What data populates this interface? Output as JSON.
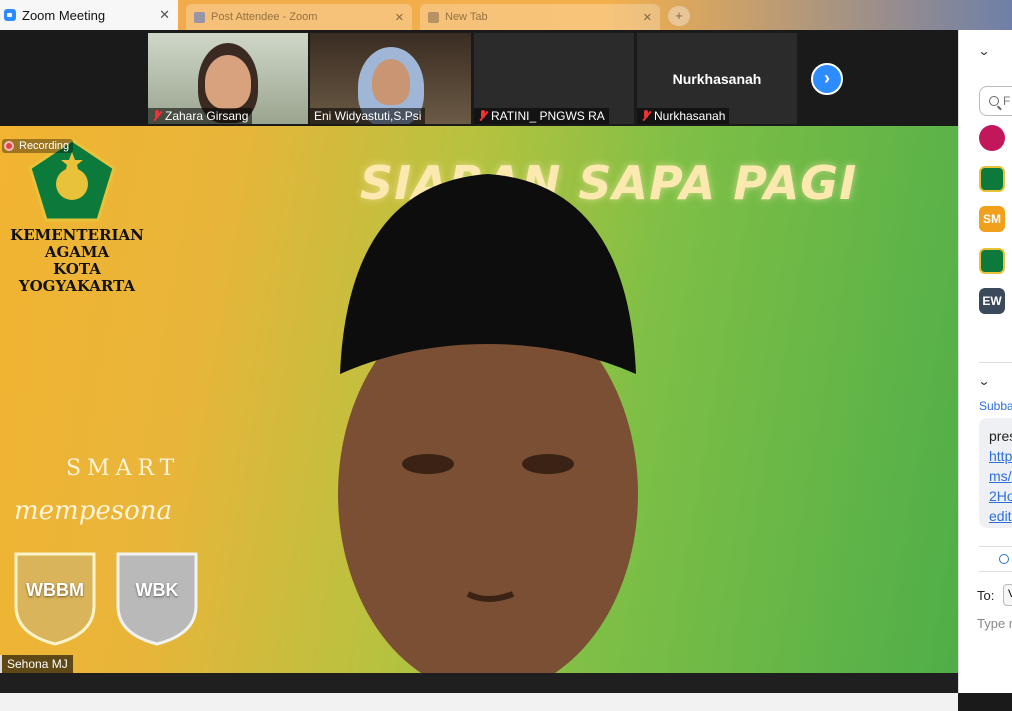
{
  "window": {
    "title": "Zoom Meeting",
    "bg_tab_1": "Post Attendee - Zoom",
    "bg_tab_2": "New Tab"
  },
  "thumbnails": [
    {
      "name": "Zahara Girsang",
      "muted": true
    },
    {
      "name": "Eni Widyastuti,S.Psi",
      "muted": true
    },
    {
      "name": "RATINI_ PNGWS RA",
      "muted": true
    },
    {
      "name": "Nurkhasanah",
      "muted": true,
      "display_name": "Nurkhasanah"
    }
  ],
  "next_icon": "chevron-right-icon",
  "main_video": {
    "recording_label": "Recording",
    "org_line_1": "KEMENTERIAN AGAMA",
    "org_line_2": "KOTA YOGYAKARTA",
    "banner": "SIARAN SAPA PAGI",
    "smart": "SMART",
    "mempesona": "mempesona",
    "badge_1": "WBBM",
    "badge_2": "WBK",
    "speaker_name": "Sehona MJ"
  },
  "panel": {
    "search_placeholder": "F",
    "participants": [
      {
        "initials": "",
        "color": "#c2185b"
      },
      {
        "initials": "",
        "color": "#0b7a3b"
      },
      {
        "initials": "SM",
        "color": "#f0a01a"
      },
      {
        "initials": "",
        "color": "#0b7a3b"
      },
      {
        "initials": "EW",
        "color": "#3b4a5a"
      }
    ],
    "chat_sender": "Subba",
    "chat_text": "pres",
    "chat_link_1": "http",
    "chat_link_2": "ms/",
    "chat_link_3": "2Ho",
    "chat_link_4": "edit",
    "to_label": "To:",
    "to_value": "V",
    "type_placeholder": "Type m"
  },
  "colors": {
    "accent": "#2d8cff",
    "muted_red": "#e33333"
  }
}
